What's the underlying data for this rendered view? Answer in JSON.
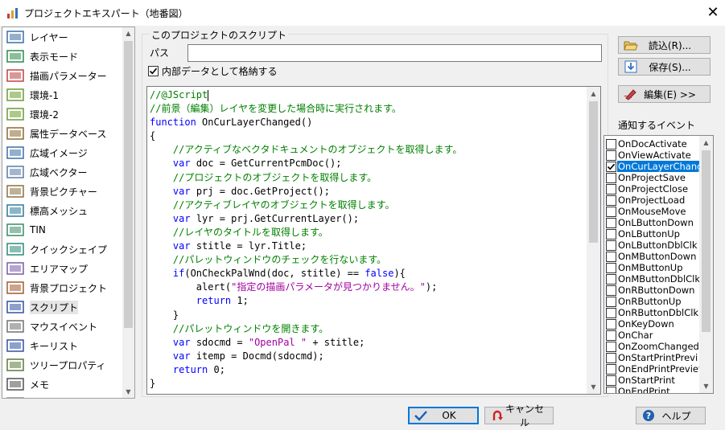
{
  "window": {
    "title": "プロジェクトエキスパート（地番図）",
    "close": "✕"
  },
  "nav": {
    "items": [
      {
        "label": "レイヤー",
        "icon": "layer-icon"
      },
      {
        "label": "表示モード",
        "icon": "display-mode-icon"
      },
      {
        "label": "描画パラメーター",
        "icon": "draw-parameter-icon"
      },
      {
        "label": "環境-1",
        "icon": "environment-icon"
      },
      {
        "label": "環境-2",
        "icon": "environment-icon"
      },
      {
        "label": "属性データベース",
        "icon": "attribute-database-icon"
      },
      {
        "label": "広域イメージ",
        "icon": "wide-image-icon"
      },
      {
        "label": "広域ベクター",
        "icon": "wide-vector-icon"
      },
      {
        "label": "背景ピクチャー",
        "icon": "background-picture-icon"
      },
      {
        "label": "標高メッシュ",
        "icon": "elevation-mesh-icon"
      },
      {
        "label": "TIN",
        "icon": "tin-icon"
      },
      {
        "label": "クイックシェイプ",
        "icon": "quick-shape-icon"
      },
      {
        "label": "エリアマップ",
        "icon": "area-map-icon"
      },
      {
        "label": "背景プロジェクト",
        "icon": "background-project-icon"
      },
      {
        "label": "スクリプト",
        "icon": "script-icon"
      },
      {
        "label": "マウスイベント",
        "icon": "mouse-icon"
      },
      {
        "label": "キーリスト",
        "icon": "key-list-icon"
      },
      {
        "label": "ツリープロパティ",
        "icon": "tree-property-icon"
      },
      {
        "label": "メモ",
        "icon": "memo-icon"
      },
      {
        "label": "",
        "icon": "partial-item-icon"
      }
    ],
    "active_index": 14
  },
  "script": {
    "group_title": "このプロジェクトのスクリプト",
    "path_label": "パス",
    "path_value": "",
    "store_internal_label": "内部データとして格納する",
    "store_internal_checked": true,
    "code_lines": [
      [
        {
          "t": "cmt",
          "v": "//@JScript"
        }
      ],
      [
        {
          "t": "cmt",
          "v": "//前景（編集）レイヤを変更した場合時に実行されます。"
        }
      ],
      [
        {
          "t": "kw",
          "v": "function"
        },
        {
          "t": "plain",
          "v": " OnCurLayerChanged()"
        }
      ],
      [
        {
          "t": "plain",
          "v": "{"
        }
      ],
      [
        {
          "t": "cmt",
          "v": "    //アクティブなベクタドキュメントのオブジェクトを取得します。"
        }
      ],
      [
        {
          "t": "plain",
          "v": "    "
        },
        {
          "t": "kw",
          "v": "var"
        },
        {
          "t": "plain",
          "v": " doc = GetCurrentPcmDoc();"
        }
      ],
      [
        {
          "t": "cmt",
          "v": "    //プロジェクトのオブジェクトを取得します。"
        }
      ],
      [
        {
          "t": "plain",
          "v": "    "
        },
        {
          "t": "kw",
          "v": "var"
        },
        {
          "t": "plain",
          "v": " prj = doc.GetProject();"
        }
      ],
      [
        {
          "t": "cmt",
          "v": "    //アクティブレイヤのオブジェクトを取得します。"
        }
      ],
      [
        {
          "t": "plain",
          "v": "    "
        },
        {
          "t": "kw",
          "v": "var"
        },
        {
          "t": "plain",
          "v": " lyr = prj.GetCurrentLayer();"
        }
      ],
      [
        {
          "t": "cmt",
          "v": "    //レイヤのタイトルを取得します。"
        }
      ],
      [
        {
          "t": "plain",
          "v": "    "
        },
        {
          "t": "kw",
          "v": "var"
        },
        {
          "t": "plain",
          "v": " stitle = lyr.Title;"
        }
      ],
      [
        {
          "t": "cmt",
          "v": "    //パレットウィンドウのチェックを行ないます。"
        }
      ],
      [
        {
          "t": "plain",
          "v": "    "
        },
        {
          "t": "kw",
          "v": "if"
        },
        {
          "t": "plain",
          "v": "(OnCheckPalWnd(doc, stitle) == "
        },
        {
          "t": "kw",
          "v": "false"
        },
        {
          "t": "plain",
          "v": "){"
        }
      ],
      [
        {
          "t": "plain",
          "v": "        alert("
        },
        {
          "t": "strp",
          "v": "\"指定の描画パラメータが見つかりません。\""
        },
        {
          "t": "plain",
          "v": ");"
        }
      ],
      [
        {
          "t": "plain",
          "v": "        "
        },
        {
          "t": "kw",
          "v": "return"
        },
        {
          "t": "plain",
          "v": " 1;"
        }
      ],
      [
        {
          "t": "plain",
          "v": "    }"
        }
      ],
      [
        {
          "t": "cmt",
          "v": "    //パレットウィンドウを開きます。"
        }
      ],
      [
        {
          "t": "plain",
          "v": "    "
        },
        {
          "t": "kw",
          "v": "var"
        },
        {
          "t": "plain",
          "v": " sdocmd = "
        },
        {
          "t": "strp",
          "v": "\"OpenPal \""
        },
        {
          "t": "plain",
          "v": " + stitle;"
        }
      ],
      [
        {
          "t": "plain",
          "v": "    "
        },
        {
          "t": "kw",
          "v": "var"
        },
        {
          "t": "plain",
          "v": " itemp = Docmd(sdocmd);"
        }
      ],
      [
        {
          "t": "plain",
          "v": "    "
        },
        {
          "t": "kw",
          "v": "return"
        },
        {
          "t": "plain",
          "v": " 0;"
        }
      ],
      [
        {
          "t": "plain",
          "v": "}"
        }
      ]
    ]
  },
  "buttons": {
    "load": "読込(R)...",
    "save": "保存(S)...",
    "edit": "編集(E) >>",
    "ok": "OK",
    "cancel": "キャンセル",
    "help": "ヘルプ"
  },
  "events": {
    "label": "通知するイベント",
    "items": [
      {
        "label": "OnDocActivate",
        "checked": false
      },
      {
        "label": "OnViewActivate",
        "checked": false
      },
      {
        "label": "OnCurLayerChang",
        "checked": true,
        "selected": true
      },
      {
        "label": "OnProjectSave",
        "checked": false
      },
      {
        "label": "OnProjectClose",
        "checked": false
      },
      {
        "label": "OnProjectLoad",
        "checked": false
      },
      {
        "label": "OnMouseMove",
        "checked": false
      },
      {
        "label": "OnLButtonDown",
        "checked": false
      },
      {
        "label": "OnLButtonUp",
        "checked": false
      },
      {
        "label": "OnLButtonDblClk",
        "checked": false
      },
      {
        "label": "OnMButtonDown",
        "checked": false
      },
      {
        "label": "OnMButtonUp",
        "checked": false
      },
      {
        "label": "OnMButtonDblClk",
        "checked": false
      },
      {
        "label": "OnRButtonDown",
        "checked": false
      },
      {
        "label": "OnRButtonUp",
        "checked": false
      },
      {
        "label": "OnRButtonDblClk",
        "checked": false
      },
      {
        "label": "OnKeyDown",
        "checked": false
      },
      {
        "label": "OnChar",
        "checked": false
      },
      {
        "label": "OnZoomChanged",
        "checked": false
      },
      {
        "label": "OnStartPrintPrevi",
        "checked": false
      },
      {
        "label": "OnEndPrintPreview",
        "checked": false
      },
      {
        "label": "OnStartPrint",
        "checked": false
      },
      {
        "label": "OnEndPrint",
        "checked": false
      }
    ]
  }
}
